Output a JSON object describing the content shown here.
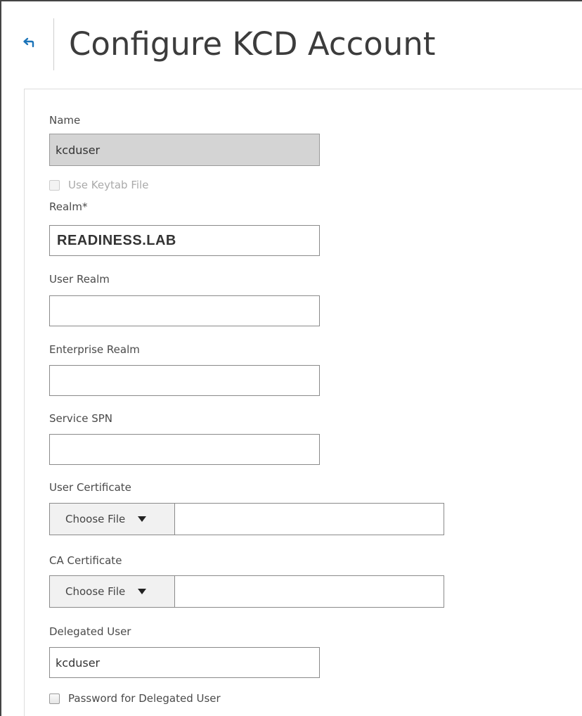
{
  "header": {
    "title": "Configure KCD Account"
  },
  "form": {
    "name_label": "Name",
    "name_value": "kcduser",
    "use_keytab_label": "Use Keytab File",
    "realm_label": "Realm*",
    "realm_value": "READINESS.LAB",
    "user_realm_label": "User Realm",
    "user_realm_value": "",
    "enterprise_realm_label": "Enterprise Realm",
    "enterprise_realm_value": "",
    "service_spn_label": "Service SPN",
    "service_spn_value": "",
    "user_certificate_label": "User Certificate",
    "user_certificate_button": "Choose File",
    "ca_certificate_label": "CA Certificate",
    "ca_certificate_button": "Choose File",
    "delegated_user_label": "Delegated User",
    "delegated_user_value": "kcduser",
    "password_delegated_label": "Password for Delegated User"
  },
  "icons": {
    "back": "back-arrow-icon",
    "dropdown": "caret-down-icon"
  },
  "colors": {
    "accent": "#1a73b8",
    "disabled_field": "#d4d4d4"
  }
}
